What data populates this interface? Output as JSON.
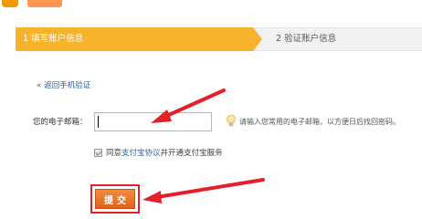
{
  "steps": {
    "step1": "1 填写账户信息",
    "step2": "2 验证账户信息"
  },
  "back_link": {
    "icon": "double-chevron-left-icon",
    "label": "返回手机验证"
  },
  "email": {
    "label": "您的电子邮箱：",
    "value": "",
    "tip_icon": "lightbulb-icon",
    "tip": "请输入您常用的电子邮箱，以方便日后找回密码。"
  },
  "agreement": {
    "checked": true,
    "prefix": "同意",
    "link": "支付宝协议",
    "suffix": "并开通支付宝服务"
  },
  "submit_label": "提交",
  "colors": {
    "step_active": "#f7b32b",
    "link": "#2e5f9e",
    "annotation_red": "#e4202a",
    "button": "#e8731f"
  }
}
